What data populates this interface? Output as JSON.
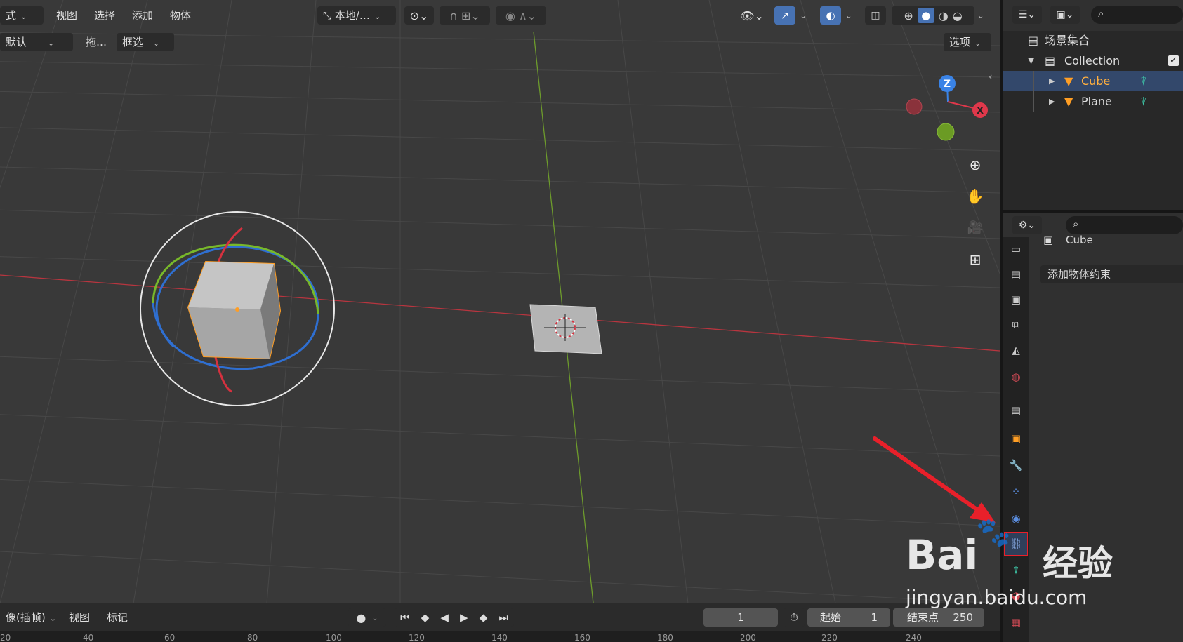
{
  "viewport_header": {
    "mode_label": "式",
    "menus": [
      "视图",
      "选择",
      "添加",
      "物体"
    ],
    "orientation_label": "本地/…",
    "row2_left": "默认",
    "row2_drag": "拖…",
    "row2_select": "框选",
    "options_label": "选项"
  },
  "gizmo": {
    "z": "Z",
    "x": "X"
  },
  "outliner": {
    "root": "场景集合",
    "collection": "Collection",
    "items": [
      "Cube",
      "Plane"
    ]
  },
  "properties": {
    "object_name": "Cube",
    "add_constraint": "添加物体约束"
  },
  "timeline": {
    "playback_label": "像(插帧)",
    "view_label": "视图",
    "marker_label": "标记",
    "current_frame": "1",
    "start_label": "起始",
    "start_value": "1",
    "end_label": "结束点",
    "end_value": "250",
    "ruler": [
      "20",
      "40",
      "60",
      "80",
      "100",
      "120",
      "140",
      "160",
      "180",
      "200",
      "220",
      "240"
    ]
  },
  "watermark": {
    "brand": "Bai",
    "brand2": "经验",
    "url": "jingyan.baidu.com"
  },
  "colors": {
    "viewport_bg": "#393939",
    "accent_blue": "#4772b3",
    "selection_orange": "#ff9e24",
    "axis_red": "#c0303c",
    "axis_green": "#6a9a2a",
    "arrow_red": "#e8202a"
  }
}
